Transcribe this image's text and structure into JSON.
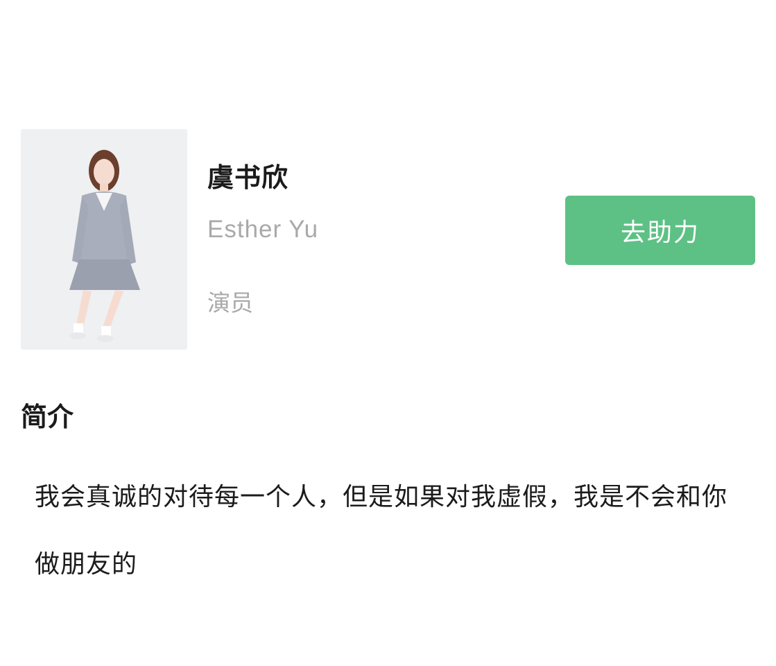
{
  "profile": {
    "name": "虞书欣",
    "english_name": "Esther Yu",
    "occupation": "演员",
    "photo_icon": "person-photo-icon"
  },
  "action": {
    "help_label": "去助力",
    "color": "#5dc185"
  },
  "intro": {
    "heading": "简介",
    "text": "我会真诚的对待每一个人，但是如果对我虚假，我是不会和你做朋友的"
  }
}
